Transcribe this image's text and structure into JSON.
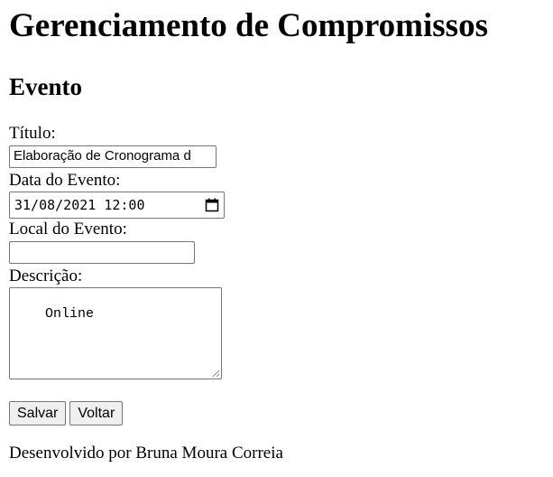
{
  "page": {
    "title": "Gerenciamento de Compromissos",
    "section_title": "Evento"
  },
  "form": {
    "titulo_label": "Título:",
    "titulo_value": "Elaboração de Cronograma d",
    "data_label": "Data do Evento:",
    "data_value": "31/08/2021 12:00",
    "local_label": "Local do Evento:",
    "local_value": "",
    "descricao_label": "Descrição:",
    "descricao_value": "Online"
  },
  "buttons": {
    "save_label": "Salvar",
    "back_label": "Voltar"
  },
  "footer": {
    "text": "Desenvolvido por Bruna Moura Correia"
  },
  "icons": {
    "calendar": "calendar-icon",
    "resize": "resize-handle-icon"
  }
}
